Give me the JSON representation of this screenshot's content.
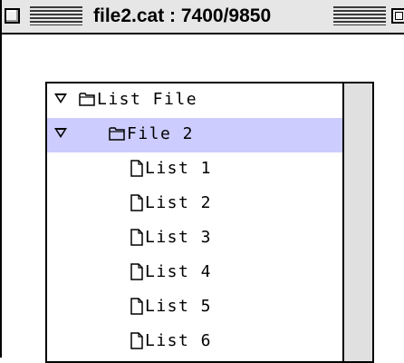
{
  "window": {
    "title": "file2.cat : 7400/9850"
  },
  "tree": {
    "items": [
      {
        "label": "List File",
        "kind": "folder",
        "expanded": true,
        "selected": false
      },
      {
        "label": "File 2",
        "kind": "folder",
        "expanded": true,
        "selected": true
      },
      {
        "label": "List 1",
        "kind": "document",
        "selected": false
      },
      {
        "label": "List 2",
        "kind": "document",
        "selected": false
      },
      {
        "label": "List 3",
        "kind": "document",
        "selected": false
      },
      {
        "label": "List 4",
        "kind": "document",
        "selected": false
      },
      {
        "label": "List 5",
        "kind": "document",
        "selected": false
      },
      {
        "label": "List 6",
        "kind": "document",
        "selected": false
      }
    ]
  },
  "colors": {
    "selection": "#ccccff",
    "titlebar": "#e6e6e6",
    "scrollbar_track": "#e0e0e0"
  }
}
